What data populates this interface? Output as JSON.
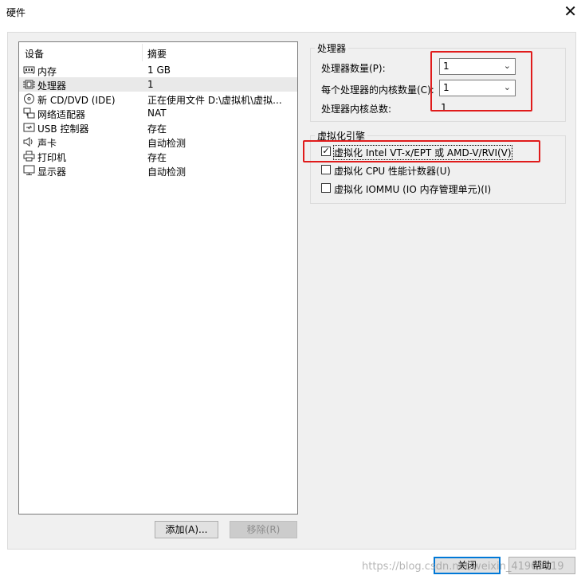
{
  "window": {
    "title": "硬件",
    "close_glyph": "✕"
  },
  "device_list": {
    "col_device": "设备",
    "col_summary": "摘要",
    "rows": [
      {
        "icon": "memory-icon",
        "name": "内存",
        "summary": "1 GB"
      },
      {
        "icon": "processor-icon",
        "name": "处理器",
        "summary": "1",
        "selected": true
      },
      {
        "icon": "cd-dvd-icon",
        "name": "新 CD/DVD (IDE)",
        "summary": "正在使用文件 D:\\虚拟机\\虚拟..."
      },
      {
        "icon": "network-adapter-icon",
        "name": "网络适配器",
        "summary": "NAT"
      },
      {
        "icon": "usb-icon",
        "name": "USB 控制器",
        "summary": "存在"
      },
      {
        "icon": "sound-card-icon",
        "name": "声卡",
        "summary": "自动检测"
      },
      {
        "icon": "printer-icon",
        "name": "打印机",
        "summary": "存在"
      },
      {
        "icon": "display-icon",
        "name": "显示器",
        "summary": "自动检测"
      }
    ]
  },
  "buttons": {
    "add": "添加(A)...",
    "remove": "移除(R)",
    "close": "关闭",
    "help": "帮助"
  },
  "processors": {
    "group_label": "处理器",
    "count_label": "处理器数量(P):",
    "count_value": "1",
    "cores_label": "每个处理器的内核数量(C):",
    "cores_value": "1",
    "total_label": "处理器内核总数:",
    "total_value": "1"
  },
  "virtualization": {
    "group_label": "虚拟化引擎",
    "options": [
      {
        "label": "虚拟化 Intel VT-x/EPT 或 AMD-V/RVI(V)",
        "checked": true
      },
      {
        "label": "虚拟化 CPU 性能计数器(U)",
        "checked": false
      },
      {
        "label": "虚拟化 IOMMU (IO 内存管理单元)(I)",
        "checked": false
      }
    ]
  },
  "watermark": "https://blog.csdn.net/weixin_41909519",
  "colors": {
    "highlight_red": "#e01b1b",
    "default_button_border": "#0078d7"
  }
}
